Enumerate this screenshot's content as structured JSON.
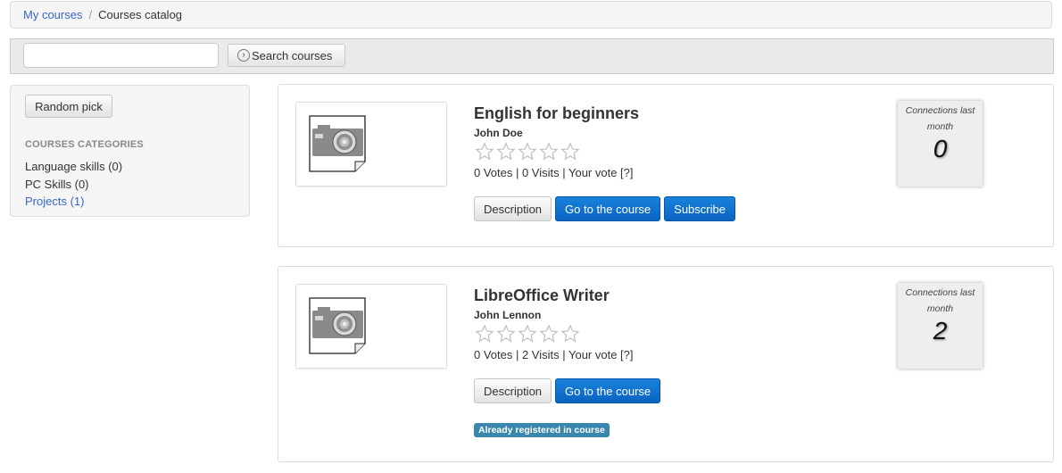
{
  "breadcrumb": {
    "home": "My courses",
    "separator": "/",
    "current": "Courses catalog"
  },
  "search": {
    "value": "",
    "placeholder": "",
    "button_label": "Search courses",
    "button_icon": "circle-chevron-right-icon"
  },
  "sidebar": {
    "random_label": "Random pick",
    "categories_title": "COURSES CATEGORIES",
    "categories": [
      {
        "label": "Language skills (0)"
      },
      {
        "label": "PC Skills (0)"
      },
      {
        "label": "Projects (1)"
      }
    ]
  },
  "courses": [
    {
      "title": "English for beginners",
      "teacher": "John Doe",
      "rating": 0,
      "stats": "0 Votes | 0 Visits | Your vote [?]",
      "buttons": {
        "description": "Description",
        "goto": "Go to the course",
        "subscribe": "Subscribe"
      },
      "connections_label": "Connections last month",
      "connections": "0"
    },
    {
      "title": "LibreOffice Writer",
      "teacher": "John Lennon",
      "rating": 0,
      "stats": "0 Votes | 2 Visits | Your vote [?]",
      "buttons": {
        "description": "Description",
        "goto": "Go to the course"
      },
      "badge": "Already registered in course",
      "connections_label": "Connections last month",
      "connections": "2"
    }
  ],
  "colors": {
    "link": "#3968c8",
    "primary": "#0a63c0",
    "badge": "#3a87ad"
  }
}
